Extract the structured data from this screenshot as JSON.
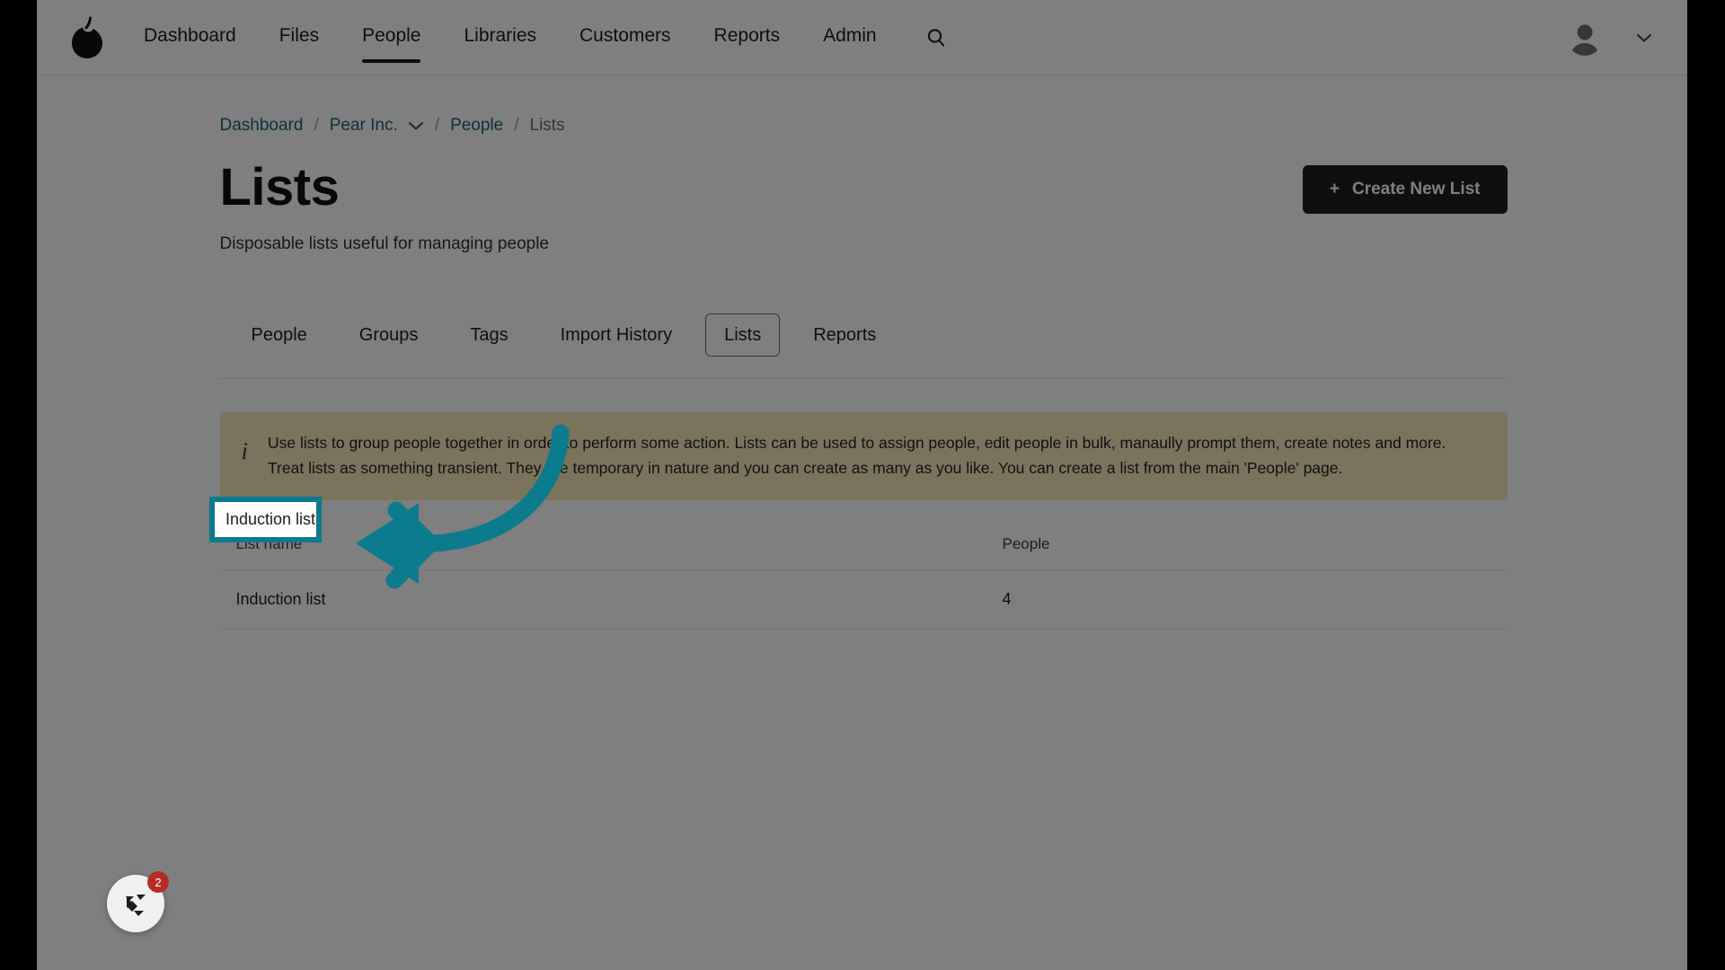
{
  "navbar": {
    "logo_icon": "pear-logo-icon",
    "links": [
      {
        "label": "Dashboard",
        "active": false
      },
      {
        "label": "Files",
        "active": false
      },
      {
        "label": "People",
        "active": true
      },
      {
        "label": "Libraries",
        "active": false
      },
      {
        "label": "Customers",
        "active": false
      },
      {
        "label": "Reports",
        "active": false
      },
      {
        "label": "Admin",
        "active": false
      }
    ],
    "search_icon": "search-icon",
    "avatar_icon": "user-avatar-icon",
    "caret_icon": "chevron-down-icon"
  },
  "breadcrumb": {
    "items": [
      {
        "label": "Dashboard",
        "current": false,
        "caret": false
      },
      {
        "label": "Pear Inc.",
        "current": false,
        "caret": true
      },
      {
        "label": "People",
        "current": false,
        "caret": false
      },
      {
        "label": "Lists",
        "current": true,
        "caret": false
      }
    ],
    "separator": "/"
  },
  "header": {
    "title": "Lists",
    "subtitle": "Disposable lists useful for managing people",
    "create_button": {
      "plus": "+",
      "label": "Create New List"
    }
  },
  "tabs": [
    {
      "label": "People",
      "selected": false
    },
    {
      "label": "Groups",
      "selected": false
    },
    {
      "label": "Tags",
      "selected": false
    },
    {
      "label": "Import History",
      "selected": false
    },
    {
      "label": "Lists",
      "selected": true
    },
    {
      "label": "Reports",
      "selected": false
    }
  ],
  "banner": {
    "icon": "info-icon",
    "icon_glyph": "i",
    "line1": "Use lists to group people together in order to perform some action. Lists can be used to assign people, edit people in bulk, manaully prompt them, create notes and more.",
    "line2": "Treat lists as something transient. They are temporary in nature and you can create as many as you like. You can create a list from the main 'People' page.",
    "background_color": "#f4e9b8"
  },
  "table": {
    "columns": [
      "List name",
      "People"
    ],
    "rows": [
      {
        "name": "Induction list",
        "people": "4"
      }
    ]
  },
  "annotation": {
    "highlight_label": "Induction list",
    "accent_color": "#0b7b8d",
    "arrow_icon": "curved-left-arrow-icon"
  },
  "widget": {
    "icon": "help-widget-icon",
    "badge_count": "2",
    "badge_color": "#b52b27"
  }
}
